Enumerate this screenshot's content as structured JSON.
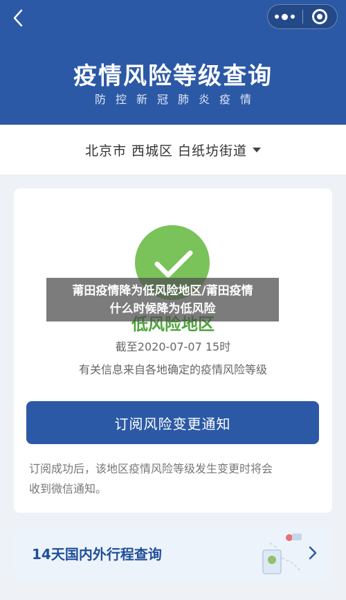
{
  "header": {
    "back_icon": "chevron-left-icon",
    "title": "疫情风险等级查询",
    "subtitle": "防控新冠肺炎疫情"
  },
  "location": {
    "text": "北京市 西城区 白纸坊街道"
  },
  "status": {
    "icon": "check-icon",
    "color": "#7ac25a",
    "risk_level": "低风险地区",
    "date": "截至2020-07-07 15时",
    "info": "有关信息来自各地确定的疫情风险等级"
  },
  "subscribe": {
    "button_label": "订阅风险变更通知",
    "note_line1": "订阅成功后，该地区疫情风险等级发生变更时将会",
    "note_line2": "收到微信通知。"
  },
  "travel": {
    "label": "14天国内外行程查询",
    "icon": "chevron-right-icon"
  },
  "overlay": {
    "line1": "莆田疫情降为低风险地区/莆田疫情",
    "line2": "什么时候降为低风险"
  },
  "colors": {
    "brand": "#2c59a6",
    "accent_green": "#7ac25a"
  }
}
